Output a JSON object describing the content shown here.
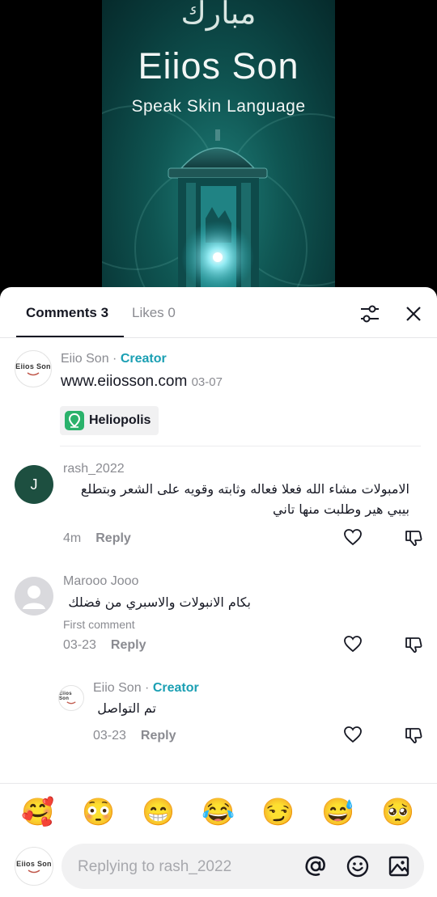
{
  "video": {
    "arabic_logo": "مبارك",
    "brand": "Eiios Son",
    "tagline": "Speak Skin Language"
  },
  "tabs": {
    "comments": "Comments 3",
    "likes": "Likes 0"
  },
  "creator_post": {
    "avatar_text": "Eiios Son",
    "username": "Eiio Son",
    "separator": " · ",
    "creator_label": "Creator",
    "text": "www.eiiosson.com",
    "date": "03-07",
    "location": "Heliopolis"
  },
  "comments": [
    {
      "avatar_letter": "J",
      "username": "rash_2022",
      "text": "الامبولات مشاء الله فعلا فعاله وثابته وقويه على الشعر وبتطلع بيبي هير وطلبت منها تاني",
      "time": "4m",
      "reply_label": "Reply"
    },
    {
      "username": "Marooo Jooo",
      "text": "بكام الانبولات والاسبري من فضلك",
      "badge": "First comment",
      "time": "03-23",
      "reply_label": "Reply"
    },
    {
      "avatar_text": "Eiios Son",
      "username": "Eiio Son",
      "separator": " · ",
      "creator_label": "Creator",
      "text": "تم التواصل",
      "time": "03-23",
      "reply_label": "Reply"
    }
  ],
  "emojis": [
    "🥰",
    "😳",
    "😁",
    "😂",
    "😏",
    "😅",
    "🥺"
  ],
  "input": {
    "avatar_text": "Eiios Son",
    "placeholder": "Replying to rash_2022"
  },
  "icons": {
    "filter": "filter-sliders-icon",
    "close": "close-icon",
    "like": "heart-outline-icon",
    "dislike": "thumbs-down-icon",
    "mention": "at-sign-icon",
    "emoji": "smiley-icon",
    "image": "image-icon",
    "location": "location-pin-icon"
  },
  "colors": {
    "creator": "#1a9fb3",
    "pin_badge": "#2ab26b",
    "avatar_j": "#1d4f40"
  }
}
